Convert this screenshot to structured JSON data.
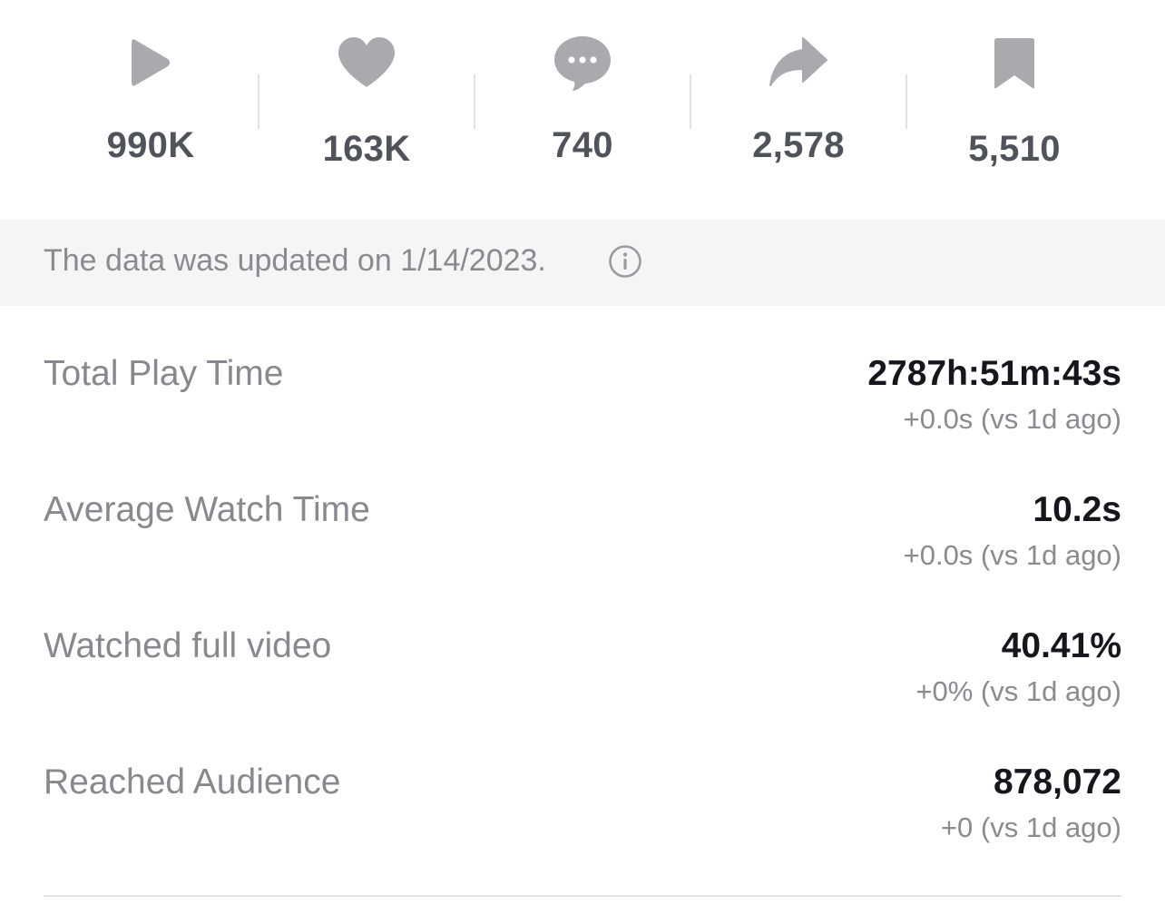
{
  "stats": [
    {
      "icon": "play-icon",
      "value": "990K"
    },
    {
      "icon": "heart-icon",
      "value": "163K"
    },
    {
      "icon": "comment-icon",
      "value": "740"
    },
    {
      "icon": "share-icon",
      "value": "2,578"
    },
    {
      "icon": "bookmark-icon",
      "value": "5,510"
    }
  ],
  "notice": {
    "text": "The data was updated on 1/14/2023.",
    "icon": "info-icon"
  },
  "metrics": [
    {
      "label": "Total Play Time",
      "value": "2787h:51m:43s",
      "delta": "+0.0s (vs 1d ago)"
    },
    {
      "label": "Average Watch Time",
      "value": "10.2s",
      "delta": "+0.0s (vs 1d ago)"
    },
    {
      "label": "Watched full video",
      "value": "40.41%",
      "delta": "+0% (vs 1d ago)"
    },
    {
      "label": "Reached Audience",
      "value": "878,072",
      "delta": "+0 (vs 1d ago)"
    }
  ],
  "colors": {
    "icon": "#a9aaae",
    "stat_value": "#50535a",
    "label": "#88898e",
    "value": "#16161d",
    "notice_bg": "#f5f5f6"
  }
}
